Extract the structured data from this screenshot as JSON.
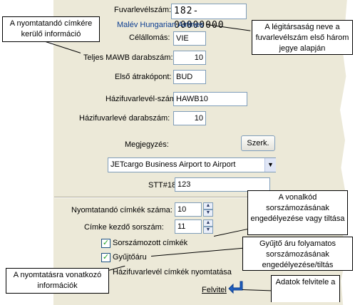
{
  "form": {
    "awb_label": "Fuvarlevélszám:",
    "awb_value": "182-00000000",
    "airline_name": "Malév Hungarian Airlines",
    "destination_label": "Célállomás:",
    "destination_value": "VIE",
    "mawb_count_label": "Teljes MAWB darabszám:",
    "mawb_count_value": "10",
    "first_transship_label": "Első átrakópont:",
    "first_transship_value": "BUD",
    "hawb_label": "Házifuvarlevél-szám:",
    "hawb_value": "HAWB10",
    "hawb_count_label": "Házifuvarlevé darabszám:",
    "hawb_count_value": "10",
    "remark_label": "Megjegyzés:",
    "edit_button": "Szerk.",
    "service_value": "JETcargo Business Airport to Airport",
    "stt_label": "STT#18",
    "stt_value": "123",
    "label_count_label": "Nyomtatandó címkék száma:",
    "label_count_value": "10",
    "label_start_label": "Címke kezdő sorszám:",
    "label_start_value": "11",
    "numbered_labels_label": "Sorszámozott címkék",
    "numbered_labels_checked": true,
    "consolidated_label": "Gyűjtőáru",
    "consolidated_checked": true,
    "hawb_print_label": "Házifuvarlevél címkék nyomtatása",
    "submit_label": "Felvitel"
  },
  "callouts": {
    "printable_info": "A nyomtatandó címkére kerülő információ",
    "airline_info": "A légitársaság neve a fuvarlevélszám első három jegye alapján",
    "barcode_info": "A vonalkód sorszámozásának engedélyezése vagy tiltása",
    "consolidated_info": "Gyűjtő áru folyamatos sorszámozásának engedélyezése/tiltás",
    "print_info": "A nyomtatásra vonatkozó információk",
    "submit_info": "Adatok felvitele a"
  },
  "colors": {
    "panel_bg": "#ece9d8",
    "airline_text": "#0b3d91",
    "check_mark": "#21a121",
    "submit_icon": "#1f5fbf"
  }
}
